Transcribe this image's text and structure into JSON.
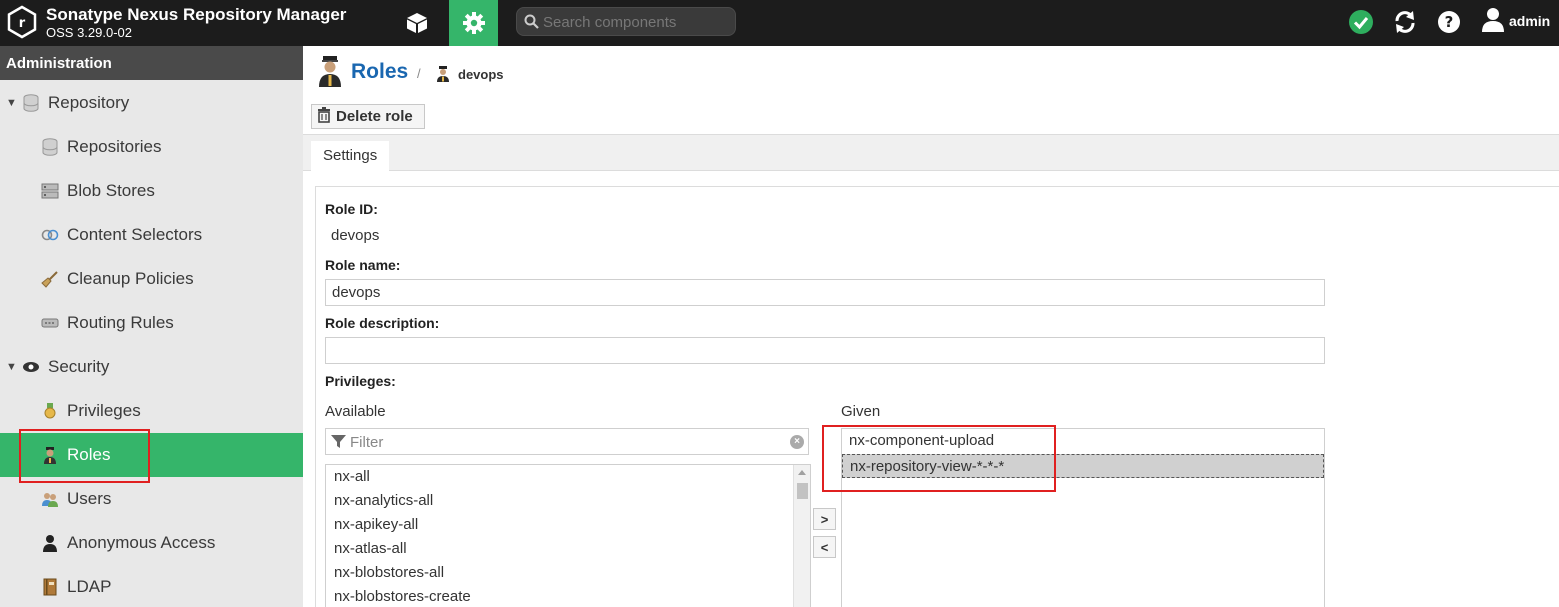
{
  "header": {
    "title": "Sonatype Nexus Repository Manager",
    "version": "OSS 3.29.0-02",
    "search_placeholder": "Search components",
    "user": "admin",
    "icons": [
      "nexus-logo-icon",
      "browse-cube-icon",
      "admin-gear-icon",
      "search-icon",
      "status-ok-icon",
      "refresh-icon",
      "help-icon",
      "user-icon"
    ],
    "accent_color": "#35b56a"
  },
  "sidebar": {
    "header": "Administration",
    "items": [
      {
        "label": "Repository",
        "icon": "database-icon",
        "type": "section"
      },
      {
        "label": "Repositories",
        "icon": "database-icon",
        "type": "item"
      },
      {
        "label": "Blob Stores",
        "icon": "server-icon",
        "type": "item"
      },
      {
        "label": "Content Selectors",
        "icon": "selector-icon",
        "type": "item"
      },
      {
        "label": "Cleanup Policies",
        "icon": "broom-icon",
        "type": "item"
      },
      {
        "label": "Routing Rules",
        "icon": "routing-icon",
        "type": "item"
      },
      {
        "label": "Security",
        "icon": "eye-icon",
        "type": "section"
      },
      {
        "label": "Privileges",
        "icon": "medal-icon",
        "type": "item"
      },
      {
        "label": "Roles",
        "icon": "officer-icon",
        "type": "item",
        "active": true
      },
      {
        "label": "Users",
        "icon": "users-icon",
        "type": "item"
      },
      {
        "label": "Anonymous Access",
        "icon": "person-icon",
        "type": "item"
      },
      {
        "label": "LDAP",
        "icon": "book-icon",
        "type": "item"
      }
    ]
  },
  "breadcrumb": {
    "root": "Roles",
    "separator": "/",
    "current": "devops"
  },
  "toolbar": {
    "delete_label": "Delete role"
  },
  "tabs": [
    "Settings"
  ],
  "form": {
    "role_id_label": "Role ID:",
    "role_id_value": "devops",
    "role_name_label": "Role name:",
    "role_name_value": "devops",
    "role_description_label": "Role description:",
    "role_description_value": "",
    "privileges_label": "Privileges:",
    "available_label": "Available",
    "given_label": "Given",
    "filter_placeholder": "Filter",
    "available": [
      "nx-all",
      "nx-analytics-all",
      "nx-apikey-all",
      "nx-atlas-all",
      "nx-blobstores-all",
      "nx-blobstores-create"
    ],
    "given": [
      "nx-component-upload",
      "nx-repository-view-*-*-*"
    ],
    "move_right": ">",
    "move_left": "<"
  }
}
